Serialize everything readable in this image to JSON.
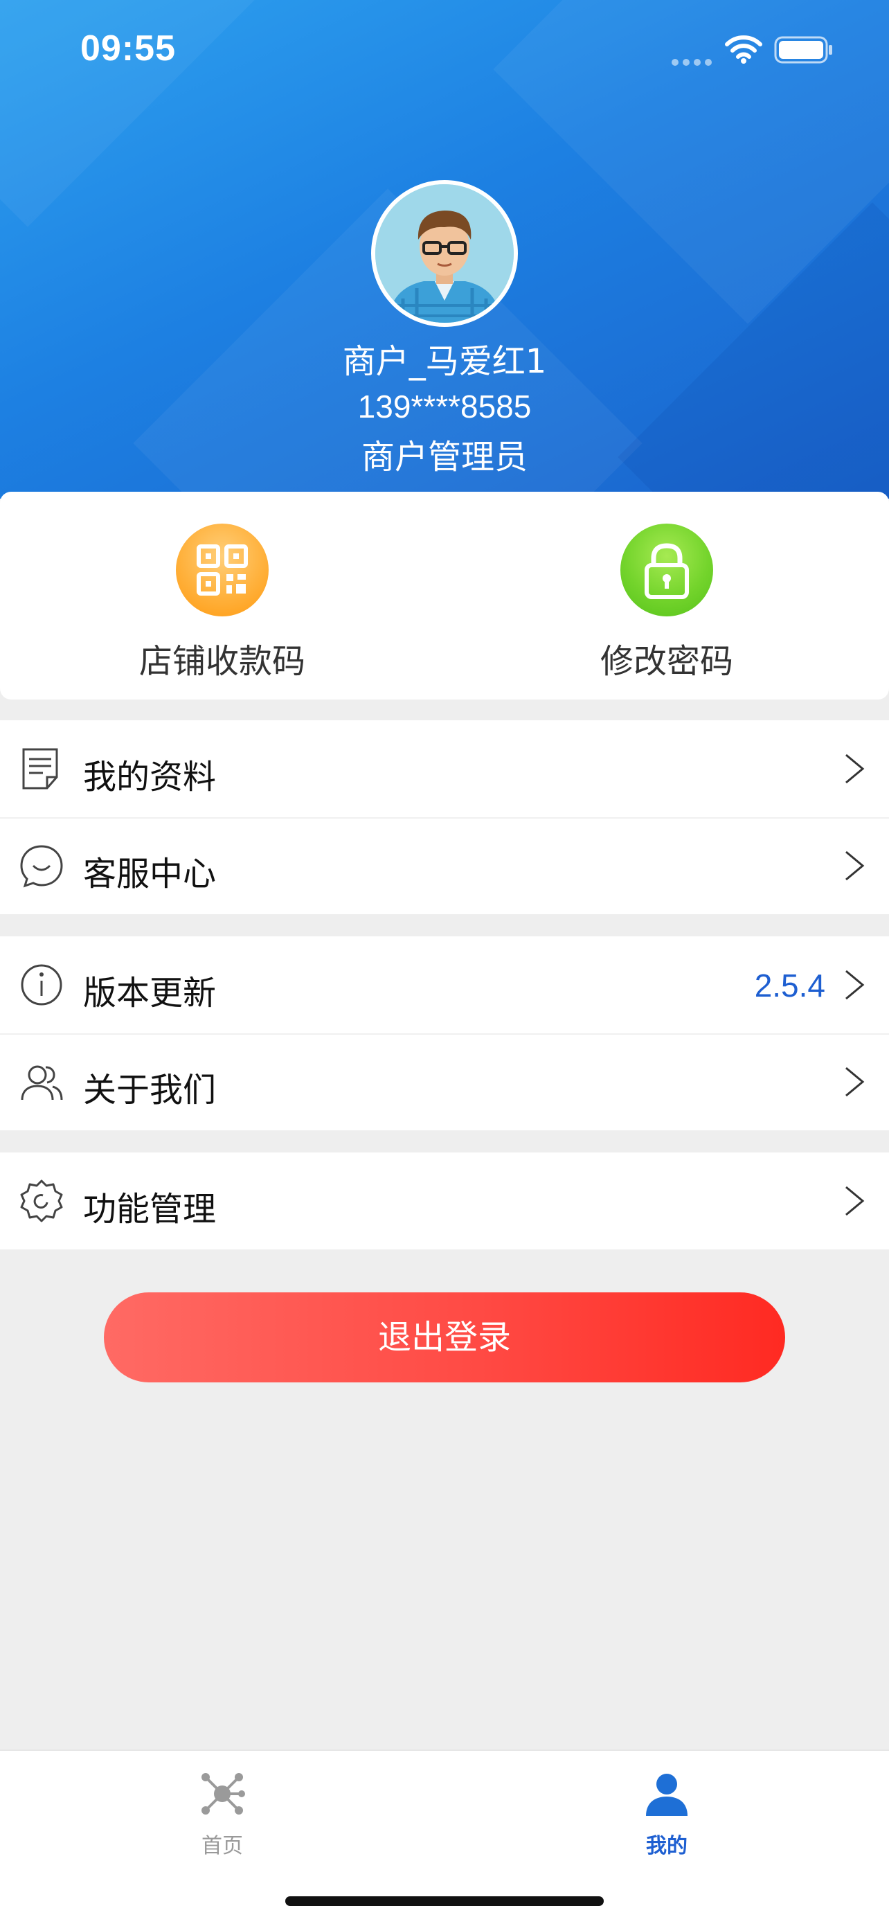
{
  "status_bar": {
    "time": "09:55",
    "icons": [
      "cellular-dots-icon",
      "wifi-icon",
      "battery-icon"
    ]
  },
  "profile": {
    "avatar_icon": "user-avatar",
    "name": "商户_马爱红1",
    "phone": "139****8585",
    "role": "商户管理员"
  },
  "quick_actions": [
    {
      "label": "店铺收款码",
      "icon": "qr-code-icon",
      "color": "#ffaa2b"
    },
    {
      "label": "修改密码",
      "icon": "lock-icon",
      "color": "#6cce26"
    }
  ],
  "menu": {
    "profile": {
      "label": "我的资料",
      "icon": "document-icon"
    },
    "service": {
      "label": "客服中心",
      "icon": "chat-bubble-icon"
    },
    "version": {
      "label": "版本更新",
      "icon": "info-icon",
      "value": "2.5.4"
    },
    "about": {
      "label": "关于我们",
      "icon": "users-icon"
    },
    "features": {
      "label": "功能管理",
      "icon": "settings-icon"
    }
  },
  "logout": {
    "label": "退出登录"
  },
  "tabs": [
    {
      "label": "首页",
      "icon": "hub-icon",
      "active": false
    },
    {
      "label": "我的",
      "icon": "person-icon",
      "active": true
    }
  ],
  "colors": {
    "header_blue": "#1d80e2",
    "accent_blue": "#1e5fd1",
    "logout_red": "#ff3a33"
  }
}
